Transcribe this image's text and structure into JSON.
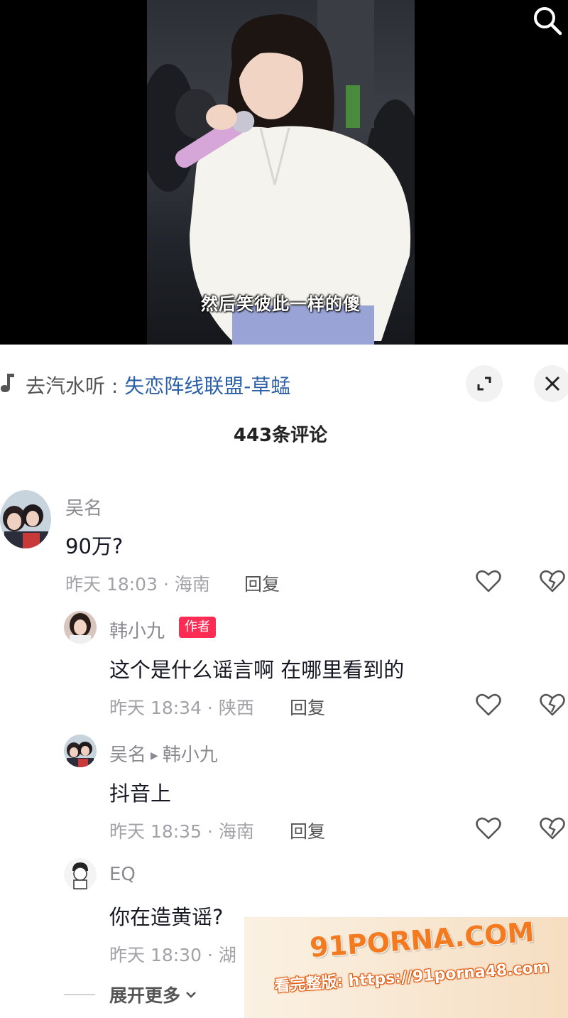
{
  "video": {
    "subtitle": "然后笑彼此一样的傻",
    "search_icon": "search-icon"
  },
  "music": {
    "prefix": "去汽水听 : ",
    "song": "失恋阵线联盟-草蜢",
    "icon": "music-note-icon"
  },
  "comments_header": "443条评论",
  "comments": [
    {
      "name": "吴名",
      "text": "90万?",
      "time": "昨天 18:03 · 海南",
      "reply_label": "回复"
    },
    {
      "name": "韩小九",
      "tag": "作者",
      "text": "这个是什么谣言啊 在哪里看到的",
      "time": "昨天 18:34 · 陕西",
      "reply_label": "回复"
    },
    {
      "name": "吴名",
      "reply_to": "韩小九",
      "text": "抖音上",
      "time": "昨天 18:35 · 海南",
      "reply_label": "回复"
    },
    {
      "name": "EQ",
      "text": "你在造黄谣?",
      "time": "昨天 18:30 · 湖"
    }
  ],
  "expand_more": "展开更多",
  "watermark": {
    "logo": "91PORNA.COM",
    "url": "看完整版: https://91porna48.com"
  }
}
